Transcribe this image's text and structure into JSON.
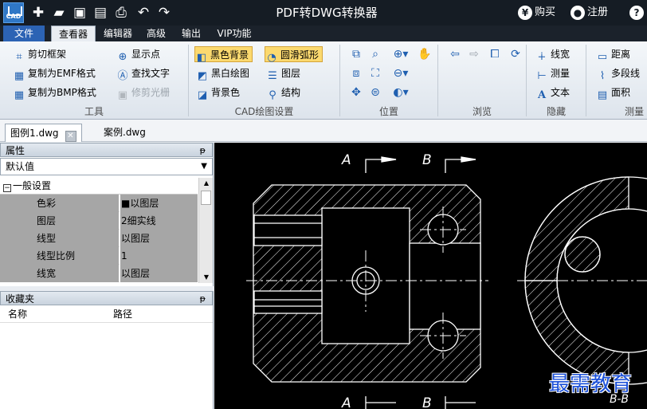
{
  "window": {
    "title": "PDF转DWG转换器",
    "buy_label": "购买",
    "register_label": "注册",
    "help_label": "?"
  },
  "menu": {
    "tabs": [
      "文件",
      "查看器",
      "编辑器",
      "高级",
      "输出",
      "VIP功能"
    ],
    "active": "查看器"
  },
  "ribbon": {
    "tools": {
      "label": "工具",
      "items": [
        "剪切框架",
        "复制为EMF格式",
        "复制为BMP格式",
        "显示点",
        "查找文字",
        "修剪光栅"
      ]
    },
    "cad_settings": {
      "label": "CAD绘图设置",
      "items": [
        "黑色背景",
        "黑白绘图",
        "背景色",
        "圆滑弧形",
        "图层",
        "结构"
      ]
    },
    "position": {
      "label": "位置"
    },
    "browse": {
      "label": "浏览"
    },
    "hidden": {
      "label": "隐藏",
      "items": [
        "线宽",
        "测量",
        "文本"
      ]
    },
    "measure": {
      "label": "测量",
      "items": [
        "距离",
        "多段线",
        "面积"
      ]
    }
  },
  "doc_tabs": [
    "图例1.dwg",
    "案例.dwg"
  ],
  "properties": {
    "title": "属性",
    "pin": "ꟼ",
    "dropdown": "默认值",
    "section": "一般设置",
    "rows": [
      {
        "key": "色彩",
        "value": "■以图层"
      },
      {
        "key": "图层",
        "value": "2细实线"
      },
      {
        "key": "线型",
        "value": "以图层"
      },
      {
        "key": "线型比例",
        "value": "1"
      },
      {
        "key": "线宽",
        "value": "以图层"
      }
    ]
  },
  "favorites": {
    "title": "收藏夹",
    "pin": "ꟼ",
    "columns": [
      "名称",
      "路径"
    ]
  },
  "drawing": {
    "section_labels": [
      "A",
      "B",
      "A",
      "B",
      "B-B"
    ]
  },
  "watermark": "最需教育",
  "colors": {
    "titlebar": "#151c24",
    "file_tab": "#2c63b4",
    "selected_button": "#fbd96f",
    "canvas": "#000000"
  }
}
